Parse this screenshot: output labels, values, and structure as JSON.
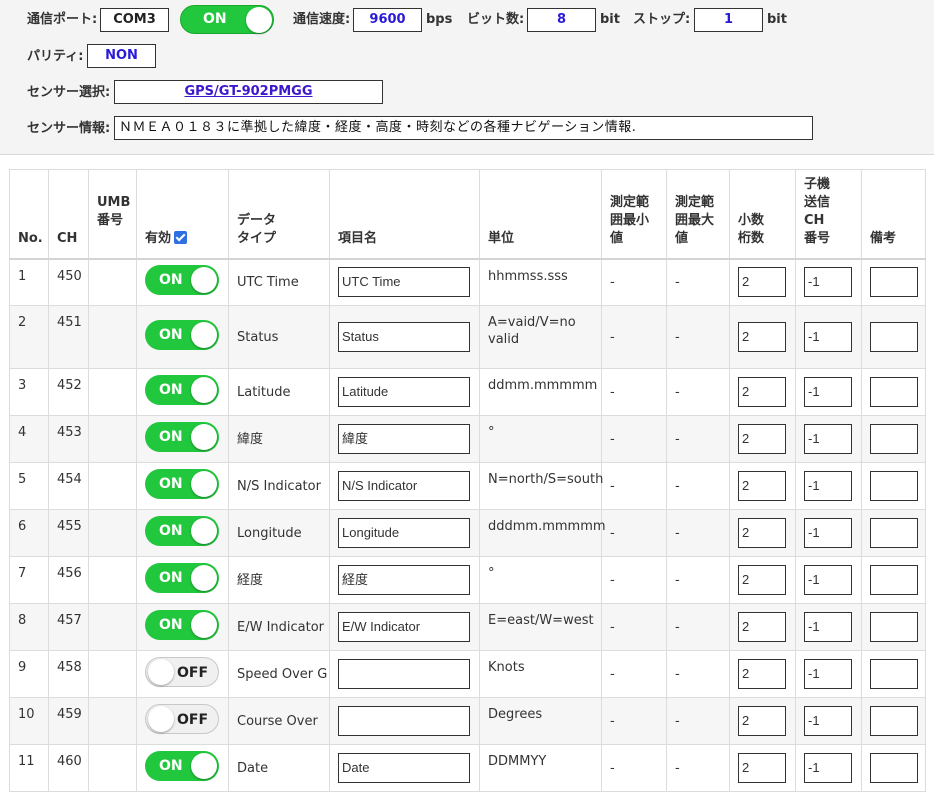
{
  "settings": {
    "port_label": "通信ポート:",
    "port_value": "COM3",
    "connection_toggle": "ON",
    "speed_label": "通信速度:",
    "speed_value": "9600",
    "speed_unit": "bps",
    "bits_label": "ビット数:",
    "bits_value": "8",
    "bits_unit": "bit",
    "stop_label": "ストップ:",
    "stop_value": "1",
    "stop_unit": "bit",
    "parity_label": "パリティ:",
    "parity_value": "NON",
    "sensor_select_label": "センサー選択:",
    "sensor_select_value": "GPS/GT-902PMGG",
    "sensor_info_label": "センサー情報:",
    "sensor_info_value": "ＮＭＥＡ０１８３に準拠した緯度・経度・高度・時刻などの各種ナビゲーション情報."
  },
  "table": {
    "headers": {
      "no": "No.",
      "ch": "CH",
      "umb_1": "UMB",
      "umb_2": "番号",
      "enabled": "有効",
      "dtype_1": "データ",
      "dtype_2": "タイプ",
      "item": "項目名",
      "unit": "単位",
      "min_1": "測定範",
      "min_2": "囲最小",
      "min_3": "値",
      "max_1": "測定範",
      "max_2": "囲最大",
      "max_3": "値",
      "dec_1": "小数",
      "dec_2": "桁数",
      "child_1": "子機",
      "child_2": "送信",
      "child_3": "CH",
      "child_4": "番号",
      "note": "備考"
    },
    "rows": [
      {
        "no": "1",
        "ch": "450",
        "umb": "",
        "toggle": "ON",
        "dtype": "UTC Time",
        "name": "UTC Time",
        "unit": "hhmmss.sss",
        "min": "-",
        "max": "-",
        "decimals": "2",
        "child_ch": "-1",
        "note": ""
      },
      {
        "no": "2",
        "ch": "451",
        "umb": "",
        "toggle": "ON",
        "dtype": "Status",
        "name": "Status",
        "unit": "A=vaid/V=no valid",
        "min": "-",
        "max": "-",
        "decimals": "2",
        "child_ch": "-1",
        "note": ""
      },
      {
        "no": "3",
        "ch": "452",
        "umb": "",
        "toggle": "ON",
        "dtype": "Latitude",
        "name": "Latitude",
        "unit": "ddmm.mmmmm",
        "min": "-",
        "max": "-",
        "decimals": "2",
        "child_ch": "-1",
        "note": ""
      },
      {
        "no": "4",
        "ch": "453",
        "umb": "",
        "toggle": "ON",
        "dtype": "緯度",
        "name": "緯度",
        "unit": "°",
        "min": "-",
        "max": "-",
        "decimals": "2",
        "child_ch": "-1",
        "note": ""
      },
      {
        "no": "5",
        "ch": "454",
        "umb": "",
        "toggle": "ON",
        "dtype": "N/S Indicator",
        "name": "N/S Indicator",
        "unit": "N=north/S=south",
        "min": "-",
        "max": "-",
        "decimals": "2",
        "child_ch": "-1",
        "note": ""
      },
      {
        "no": "6",
        "ch": "455",
        "umb": "",
        "toggle": "ON",
        "dtype": "Longitude",
        "name": "Longitude",
        "unit": "dddmm.mmmmm",
        "min": "-",
        "max": "-",
        "decimals": "2",
        "child_ch": "-1",
        "note": ""
      },
      {
        "no": "7",
        "ch": "456",
        "umb": "",
        "toggle": "ON",
        "dtype": "経度",
        "name": "経度",
        "unit": "°",
        "min": "-",
        "max": "-",
        "decimals": "2",
        "child_ch": "-1",
        "note": ""
      },
      {
        "no": "8",
        "ch": "457",
        "umb": "",
        "toggle": "ON",
        "dtype": "E/W Indicator",
        "name": "E/W Indicator",
        "unit": "E=east/W=west",
        "min": "-",
        "max": "-",
        "decimals": "2",
        "child_ch": "-1",
        "note": ""
      },
      {
        "no": "9",
        "ch": "458",
        "umb": "",
        "toggle": "OFF",
        "dtype": "Speed Over G",
        "name": "",
        "unit": "Knots",
        "min": "-",
        "max": "-",
        "decimals": "2",
        "child_ch": "-1",
        "note": ""
      },
      {
        "no": "10",
        "ch": "459",
        "umb": "",
        "toggle": "OFF",
        "dtype": "Course Over",
        "name": "",
        "unit": "Degrees",
        "min": "-",
        "max": "-",
        "decimals": "2",
        "child_ch": "-1",
        "note": ""
      },
      {
        "no": "11",
        "ch": "460",
        "umb": "",
        "toggle": "ON",
        "dtype": "Date",
        "name": "Date",
        "unit": "DDMMYY",
        "min": "-",
        "max": "-",
        "decimals": "2",
        "child_ch": "-1",
        "note": ""
      }
    ]
  },
  "colors": {
    "toggle_on": "#21c73c",
    "value_blue": "#2a1ad8",
    "checkbox": "#2f6fe4"
  }
}
